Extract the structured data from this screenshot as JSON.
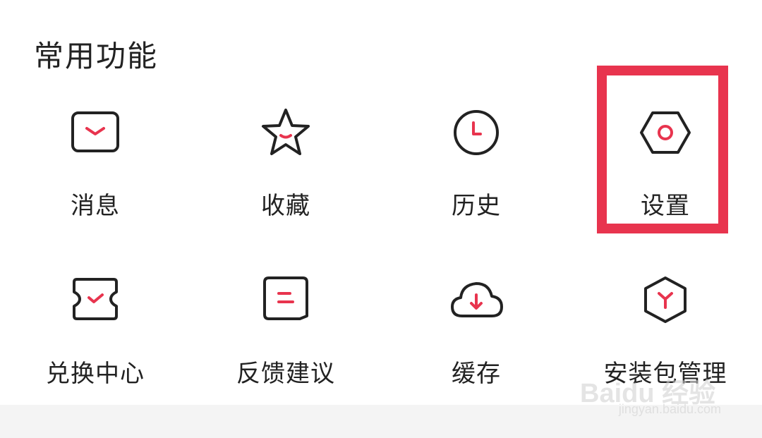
{
  "section": {
    "title": "常用功能"
  },
  "tiles": [
    {
      "label": "消息",
      "icon": "message-icon"
    },
    {
      "label": "收藏",
      "icon": "star-icon"
    },
    {
      "label": "历史",
      "icon": "clock-icon"
    },
    {
      "label": "设置",
      "icon": "settings-hexagon-icon"
    },
    {
      "label": "兑换中心",
      "icon": "ticket-icon"
    },
    {
      "label": "反馈建议",
      "icon": "feedback-icon"
    },
    {
      "label": "缓存",
      "icon": "cloud-download-icon"
    },
    {
      "label": "安装包管理",
      "icon": "package-icon"
    }
  ],
  "colors": {
    "accent": "#e8344e",
    "icon_stroke": "#222222",
    "highlight": "#e8344e"
  },
  "watermark": {
    "brand": "Baidu 经验",
    "url": "jingyan.baidu.com"
  }
}
